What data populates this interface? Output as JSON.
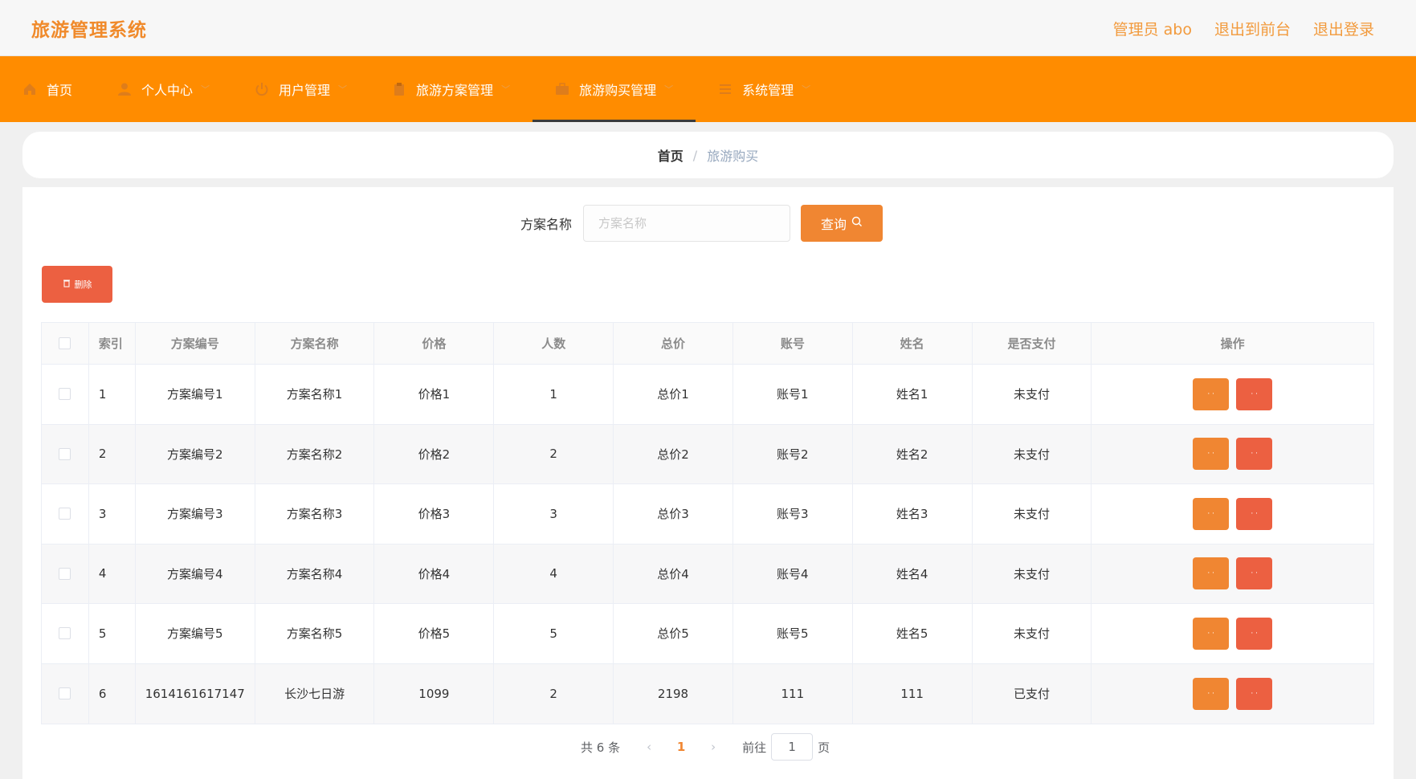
{
  "header": {
    "title": "旅游管理系统",
    "admin_label": "管理员 abo",
    "front_label": "退出到前台",
    "logout_label": "退出登录"
  },
  "nav": {
    "items": [
      {
        "label": "首页",
        "icon": "home-icon"
      },
      {
        "label": "个人中心",
        "icon": "user-icon"
      },
      {
        "label": "用户管理",
        "icon": "power-icon"
      },
      {
        "label": "旅游方案管理",
        "icon": "clipboard-icon"
      },
      {
        "label": "旅游购买管理",
        "icon": "briefcase-icon"
      },
      {
        "label": "系统管理",
        "icon": "sliders-icon"
      }
    ],
    "active_index": 4
  },
  "breadcrumb": {
    "home": "首页",
    "separator": "/",
    "current": "旅游购买"
  },
  "search": {
    "label": "方案名称",
    "placeholder": "方案名称",
    "value": "",
    "button_label": "查询"
  },
  "toolbar": {
    "delete_label": "删除"
  },
  "table": {
    "columns": [
      "索引",
      "方案编号",
      "方案名称",
      "价格",
      "人数",
      "总价",
      "账号",
      "姓名",
      "是否支付",
      "操作"
    ],
    "rows": [
      [
        "1",
        "方案编号1",
        "方案名称1",
        "价格1",
        "1",
        "总价1",
        "账号1",
        "姓名1",
        "未支付"
      ],
      [
        "2",
        "方案编号2",
        "方案名称2",
        "价格2",
        "2",
        "总价2",
        "账号2",
        "姓名2",
        "未支付"
      ],
      [
        "3",
        "方案编号3",
        "方案名称3",
        "价格3",
        "3",
        "总价3",
        "账号3",
        "姓名3",
        "未支付"
      ],
      [
        "4",
        "方案编号4",
        "方案名称4",
        "价格4",
        "4",
        "总价4",
        "账号4",
        "姓名4",
        "未支付"
      ],
      [
        "5",
        "方案编号5",
        "方案名称5",
        "价格5",
        "5",
        "总价5",
        "账号5",
        "姓名5",
        "未支付"
      ],
      [
        "6",
        "1614161617147",
        "长沙七日游",
        "1099",
        "2",
        "2198",
        "111",
        "111",
        "已支付"
      ]
    ]
  },
  "pagination": {
    "total": "共 6 条",
    "current_page": "1",
    "goto_label": "前往",
    "goto_value": "1",
    "page_suffix": "页"
  },
  "colors": {
    "accent": "#ff8c00",
    "brand": "#f08a2b",
    "danger": "#ec6041",
    "button": "#f08632"
  }
}
